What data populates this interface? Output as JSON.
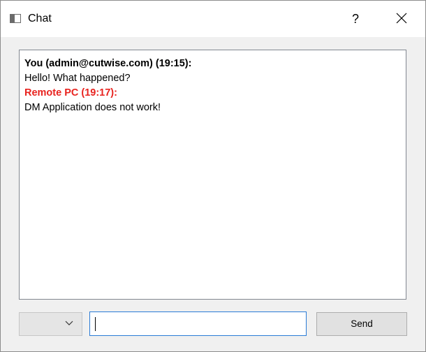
{
  "window": {
    "title": "Chat",
    "help_label": "?"
  },
  "chat": {
    "messages": [
      {
        "header": "You (admin@cutwise.com) (19:15):",
        "text": "Hello! What happened?",
        "sender": "local",
        "header_color": "#000000"
      },
      {
        "header": "Remote PC (19:17):",
        "text": "DM Application does not work!",
        "sender": "remote",
        "header_color": "#e8231f"
      }
    ]
  },
  "input": {
    "value": "",
    "recipient_selected": ""
  },
  "send_button": {
    "label": "Send"
  },
  "icons": {
    "app": "window-icon",
    "help": "help-icon",
    "close": "close-icon",
    "dropdown": "chevron-down-icon"
  },
  "colors": {
    "remote_sender": "#e8231f",
    "input_focus_border": "#2a7bd6"
  }
}
